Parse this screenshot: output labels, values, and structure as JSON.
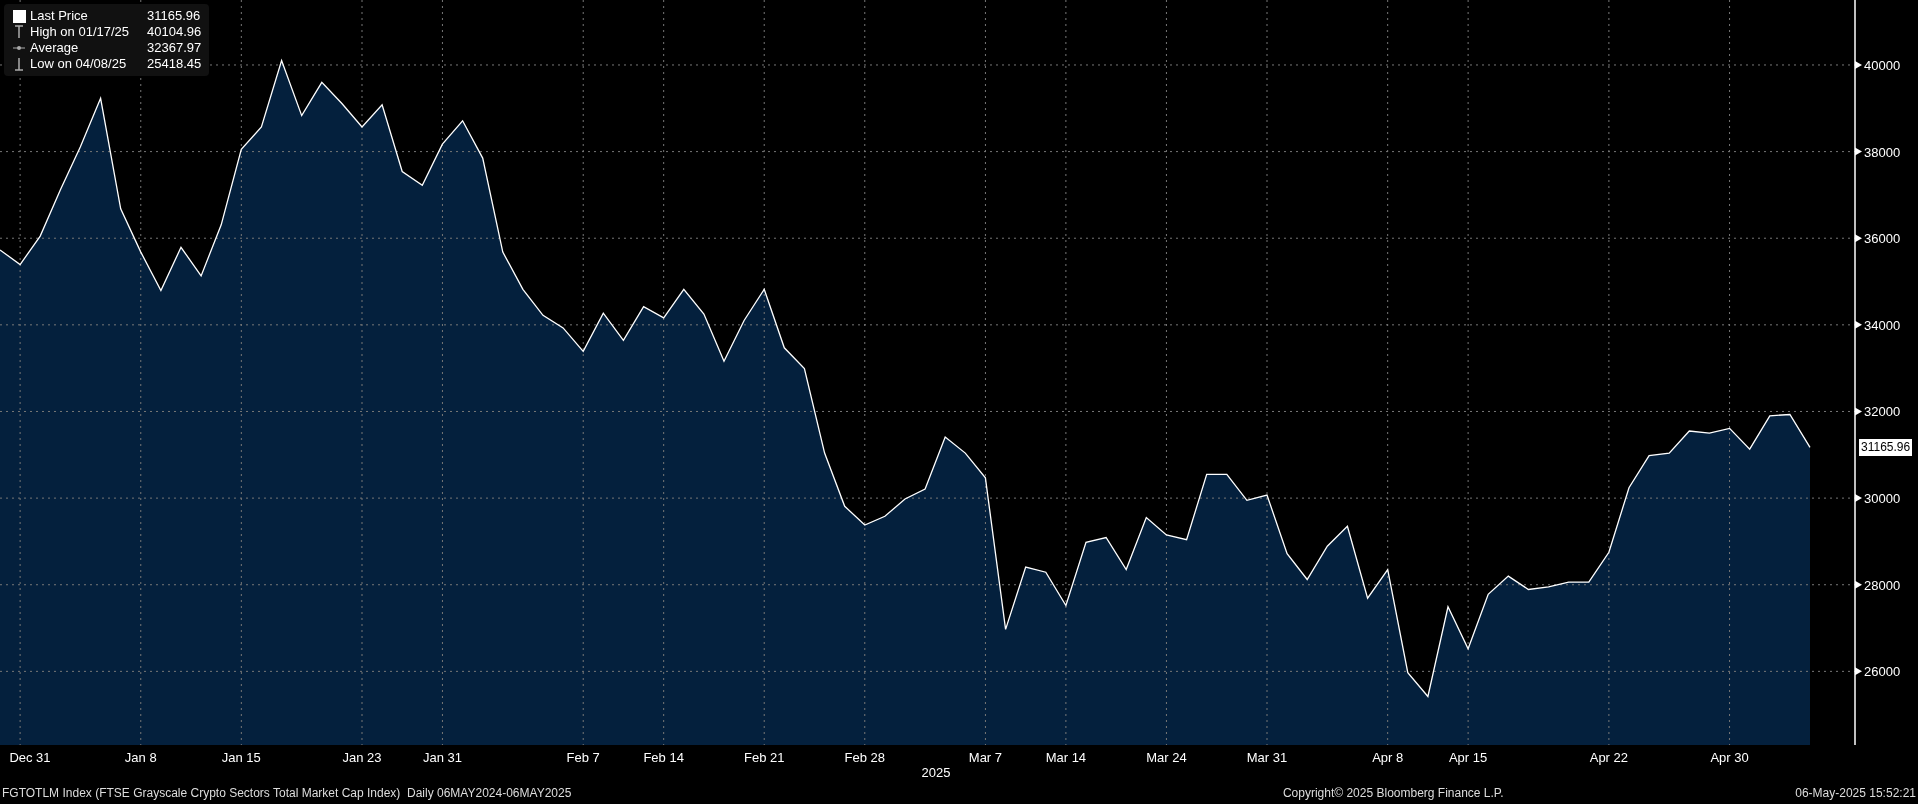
{
  "legend": [
    {
      "kind": "last",
      "value": "31165.96"
    },
    {
      "kind": "high",
      "label": "High on 01/17/25",
      "value": "40104.96"
    },
    {
      "kind": "average",
      "label": "Average",
      "value": "32367.97"
    },
    {
      "kind": "low",
      "label": "Low on 04/08/25",
      "value": "25418.45"
    }
  ],
  "last_price_tag": "31165.96",
  "year_label": "2025",
  "x_axis_labels": [
    "Dec 31",
    "Jan 8",
    "Jan 15",
    "Jan 23",
    "Jan 31",
    "Feb 7",
    "Feb 14",
    "Feb 21",
    "Feb 28",
    "Mar 7",
    "Mar 14",
    "Mar 24",
    "Mar 31",
    "Apr 8",
    "Apr 15",
    "Apr 22",
    "Apr 30"
  ],
  "chart_data": {
    "type": "area",
    "grid": true,
    "series": [
      {
        "name": "Last Price",
        "color": "#ffffff",
        "values": [
          35730,
          35390,
          36050,
          37110,
          38110,
          39230,
          36680,
          35680,
          34790,
          35790,
          35130,
          36310,
          38050,
          38570,
          40100,
          38830,
          39600,
          39110,
          38570,
          39080,
          37540,
          37220,
          38170,
          38710,
          37850,
          35680,
          34820,
          34220,
          33930,
          33390,
          34270,
          33640,
          34420,
          34160,
          34820,
          34250,
          33160,
          34100,
          34820,
          33470,
          32990,
          31040,
          29810,
          29380,
          29580,
          29980,
          30210,
          31410,
          31040,
          30470,
          26970,
          28410,
          28290,
          27520,
          28980,
          29090,
          28350,
          29550,
          29150,
          29040,
          30550,
          30550,
          29950,
          30070,
          28720,
          28120,
          28890,
          29350,
          27690,
          28350,
          25970,
          25420,
          27490,
          26520,
          27780,
          28200,
          27890,
          27950,
          28060,
          28060,
          28750,
          30240,
          30980,
          31040,
          31550,
          31500,
          31610,
          31130,
          31900,
          31930,
          31170
        ]
      }
    ],
    "ylim": [
      24300,
      41500
    ],
    "yticks": [
      26000,
      28000,
      30000,
      32000,
      34000,
      36000,
      38000,
      40000
    ]
  },
  "footer": {
    "description": "FGTOTLM Index (FTSE Grayscale Crypto Sectors Total Market Cap Index)  Daily 06MAY2024-06MAY2025",
    "copyright": "Copyright© 2025 Bloomberg Finance L.P.",
    "timestamp": "06-May-2025 15:52:21"
  }
}
